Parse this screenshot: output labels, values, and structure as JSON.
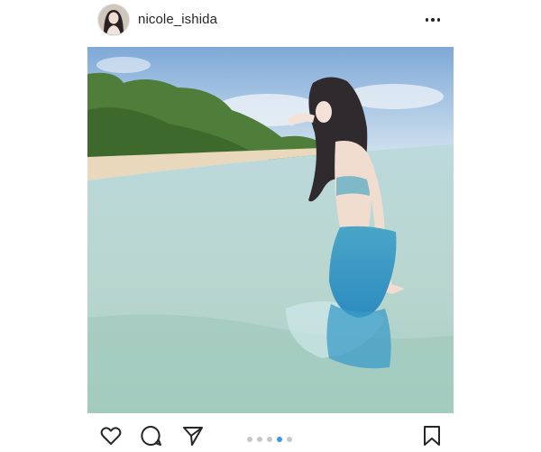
{
  "post": {
    "username": "nicole_ishida",
    "avatar_icon": "profile-photo",
    "more_icon": "more-options-icon"
  },
  "actions": {
    "like_icon": "heart-icon",
    "comment_icon": "comment-icon",
    "share_icon": "send-icon",
    "save_icon": "bookmark-icon"
  },
  "carousel": {
    "total": 5,
    "active_index": 4
  },
  "colors": {
    "text": "#262626",
    "active_dot": "#3897f0",
    "inactive_dot": "#c8c8c8"
  }
}
